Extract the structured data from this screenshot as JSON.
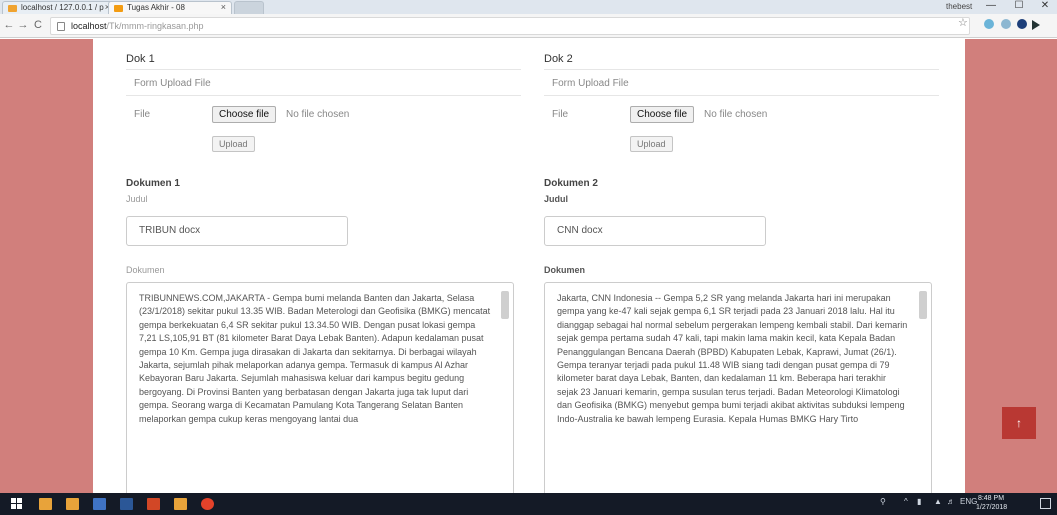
{
  "browser": {
    "tabs": [
      {
        "label": "localhost / 127.0.0.1 / p",
        "close": "×",
        "favicon_color": "#f0a330"
      },
      {
        "label": "Tugas Akhir - 08",
        "close": "×",
        "favicon_color": "#f39c12"
      }
    ],
    "user_label": "thebest",
    "window_controls": {
      "minimize": "—",
      "maximize": "☐",
      "close": "✕"
    },
    "nav": {
      "back": "←",
      "forward": "→",
      "reload": "C"
    },
    "url_host": "localhost",
    "url_path": "/Tk/mmm-ringkasan.php",
    "star": "☆"
  },
  "left_panel": {
    "header": "Dok 1",
    "upload_title": "Form Upload File",
    "file_label": "File",
    "choose_label": "Choose file",
    "no_file": "No file chosen",
    "upload_label": "Upload",
    "doc_title": "Dokumen 1",
    "judul_label": "Judul",
    "judul_value": "TRIBUN docx",
    "dokumen_label": "Dokumen",
    "text": "TRIBUNNEWS.COM,JAKARTA - Gempa bumi melanda Banten dan Jakarta, Selasa (23/1/2018) sekitar pukul 13.35 WIB. Badan Meterologi dan Geofisika (BMKG) mencatat gempa berkekuatan 6,4 SR sekitar pukul 13.34.50 WIB. Dengan pusat lokasi gempa 7,21 LS,105,91 BT (81 kilometer Barat Daya Lebak Banten). Adapun kedalaman pusat gempa 10 Km. Gempa juga dirasakan di Jakarta dan sekitarnya. Di berbagai wilayah Jakarta, sejumlah pihak melaporkan adanya gempa. Termasuk di kampus Al Azhar Kebayoran Baru Jakarta. Sejumlah mahasiswa keluar dari kampus begitu gedung bergoyang. Di Provinsi Banten yang berbatasan dengan Jakarta juga tak luput dari gempa. Seorang warga di Kecamatan Pamulang Kota Tangerang Selatan Banten melaporkan gempa cukup keras mengoyang lantai dua"
  },
  "right_panel": {
    "header": "Dok 2",
    "upload_title": "Form Upload File",
    "file_label": "File",
    "choose_label": "Choose file",
    "no_file": "No file chosen",
    "upload_label": "Upload",
    "doc_title": "Dokumen 2",
    "judul_label": "Judul",
    "judul_value": "CNN docx",
    "dokumen_label": "Dokumen",
    "text": "Jakarta, CNN Indonesia -- Gempa 5,2 SR yang melanda Jakarta hari ini merupakan gempa yang ke-47 kali sejak gempa 6,1 SR terjadi pada 23 Januari 2018 lalu. Hal itu dianggap sebagai hal normal sebelum pergerakan lempeng kembali stabil. Dari kemarin sejak gempa pertama sudah 47 kali, tapi makin lama makin kecil, kata Kepala Badan Penanggulangan Bencana Daerah (BPBD) Kabupaten Lebak, Kaprawi, Jumat (26/1). Gempa teranyar terjadi pada pukul 11.48 WIB siang tadi dengan pusat gempa di 79 kilometer barat daya Lebak, Banten, dan kedalaman 11 km. Beberapa hari terakhir sejak 23 Januari kemarin, gempa susulan terus terjadi. Badan Meteorologi Klimatologi dan Geofisika (BMKG) menyebut gempa bumi terjadi akibat aktivitas subduksi lempeng Indo-Australia ke bawah lempeng Eurasia. Kepala Humas BMKG Hary Tirto"
  },
  "back_to_top": "↑",
  "taskbar": {
    "clock_time": "8:48 PM",
    "clock_date": "1/27/2018",
    "tray_text": "ENG"
  }
}
